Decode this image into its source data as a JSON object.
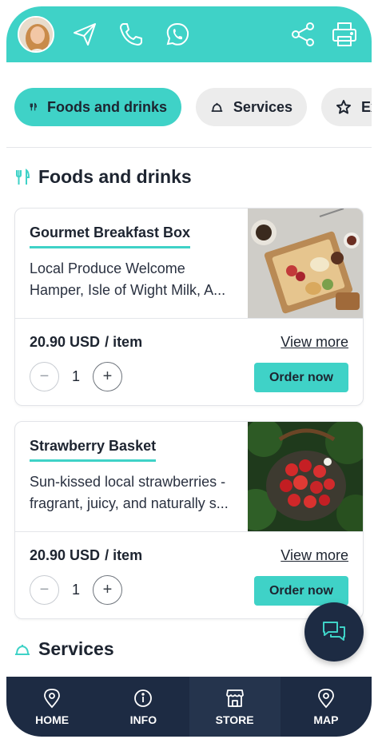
{
  "header": {
    "avatar_icon": "user-avatar",
    "icons": [
      "send-icon",
      "phone-icon",
      "whatsapp-icon",
      "share-icon",
      "print-icon"
    ],
    "color": "#3fd2c7"
  },
  "tabs": [
    {
      "label": "Foods and drinks",
      "icon": "fork-knife-icon",
      "active": true
    },
    {
      "label": "Services",
      "icon": "cloche-icon",
      "active": false
    },
    {
      "label": "Ex",
      "icon": "star-icon",
      "active": false
    }
  ],
  "sections": {
    "foods": {
      "title": "Foods and drinks",
      "icon": "fork-knife-icon"
    },
    "services": {
      "title": "Services",
      "icon": "cloche-icon"
    }
  },
  "products": [
    {
      "name": "Gourmet Breakfast Box",
      "description": "Local Produce Welcome Hamper, Isle of Wight Milk, A...",
      "price": "20.90 USD",
      "unit": "/ item",
      "view_more": "View more",
      "quantity": "1",
      "order_label": "Order now",
      "minus": "−",
      "plus": "+"
    },
    {
      "name": "Strawberry Basket",
      "description": "Sun-kissed local strawberries - fragrant, juicy, and naturally s...",
      "price": "20.90 USD",
      "unit": "/ item",
      "view_more": "View more",
      "quantity": "1",
      "order_label": "Order now",
      "minus": "−",
      "plus": "+"
    }
  ],
  "chat_button_icon": "chat-bubbles-icon",
  "bottom_nav": [
    {
      "label": "HOME",
      "icon": "location-pin-icon",
      "active": false
    },
    {
      "label": "INFO",
      "icon": "info-icon",
      "active": false
    },
    {
      "label": "STORE",
      "icon": "store-icon",
      "active": true
    },
    {
      "label": "MAP",
      "icon": "location-pin-icon",
      "active": false
    }
  ],
  "colors": {
    "accent": "#3fd2c7",
    "navy": "#1d2b43"
  }
}
